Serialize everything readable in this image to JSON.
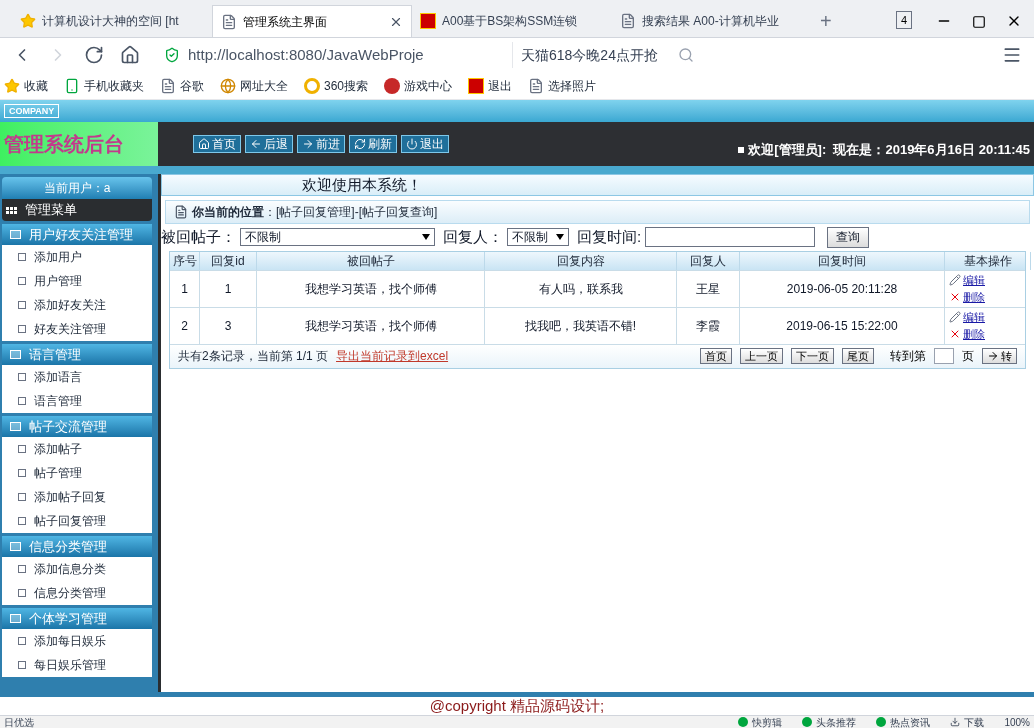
{
  "browser": {
    "tabs": [
      {
        "label": "计算机设计大神的空间 [ht",
        "selected": false,
        "kind": "star"
      },
      {
        "label": "管理系统主界面",
        "selected": true,
        "kind": "page"
      },
      {
        "label": "A00基于BS架构SSM连锁",
        "selected": false,
        "kind": "red"
      },
      {
        "label": "搜索结果 A00-计算机毕业",
        "selected": false,
        "kind": "page"
      }
    ],
    "tab_count": "4",
    "new_tab": "+",
    "address": "http://localhost:8080/JavaWebProje",
    "search_hint": "天猫618今晚24点开抢",
    "bookmarks": [
      {
        "label": "收藏",
        "kind": "star"
      },
      {
        "label": "手机收藏夹",
        "kind": "phone"
      },
      {
        "label": "谷歌",
        "kind": "page"
      },
      {
        "label": "网址大全",
        "kind": "globe"
      },
      {
        "label": "360搜索",
        "kind": "ring"
      },
      {
        "label": "游戏中心",
        "kind": "game"
      },
      {
        "label": "退出",
        "kind": "red"
      },
      {
        "label": "选择照片",
        "kind": "page"
      }
    ]
  },
  "header": {
    "company": "COMPANY",
    "title": "管理系统后台",
    "nav": [
      "首页",
      "后退",
      "前进",
      "刷新",
      "退出"
    ],
    "welcome": "欢迎[管理员]:  现在是：2019年6月16日 20:11:45"
  },
  "sidebar": {
    "current_user": "当前用户：a",
    "menu_title": "管理菜单",
    "groups": [
      {
        "title": "用户好友关注管理",
        "items": [
          "添加用户",
          "用户管理",
          "添加好友关注",
          "好友关注管理"
        ]
      },
      {
        "title": "语言管理",
        "items": [
          "添加语言",
          "语言管理"
        ]
      },
      {
        "title": "帖子交流管理",
        "items": [
          "添加帖子",
          "帖子管理",
          "添加帖子回复",
          "帖子回复管理"
        ]
      },
      {
        "title": "信息分类管理",
        "items": [
          "添加信息分类",
          "信息分类管理"
        ]
      },
      {
        "title": "个体学习管理",
        "items": [
          "添加每日娱乐",
          "每日娱乐管理"
        ]
      }
    ]
  },
  "main": {
    "welcome": "欢迎使用本系统！",
    "breadcrumb": "**你当前的位置**：[帖子回复管理]-[帖子回复查询]",
    "filters": {
      "post_label": "被回帖子：",
      "post_value": "不限制",
      "replier_label": "回复人：",
      "replier_value": "不限制",
      "time_label": "回复时间:",
      "search_button": "查询"
    },
    "table": {
      "columns": [
        "序号",
        "回复id",
        "被回帖子",
        "回复内容",
        "回复人",
        "回复时间",
        "基本操作"
      ],
      "rows": [
        {
          "cells": [
            "1",
            "1",
            "我想学习英语，找个师傅",
            "有人吗，联系我",
            "王星",
            "2019-06-05 20:11:28"
          ],
          "actions": [
            "编辑",
            "删除"
          ]
        },
        {
          "cells": [
            "2",
            "3",
            "我想学习英语，找个师傅",
            "找我吧，我英语不错!",
            "李霞",
            "2019-06-15 15:22:00"
          ],
          "actions": [
            "编辑",
            "删除"
          ]
        }
      ]
    },
    "pager": {
      "summary": "共有2条记录，当前第 1/1 页",
      "export": "导出当前记录到excel",
      "buttons": [
        "首页",
        "上一页",
        "下一页",
        "尾页"
      ],
      "goto_label": "转到第",
      "goto_unit": "页",
      "go_button": "转"
    }
  },
  "footer": "@copyright 精品源码设计;",
  "status_bar": {
    "left": "日优选",
    "items": [
      "快剪辑",
      "头条推荐",
      "热点资讯",
      "下载"
    ],
    "zoom": "100%"
  }
}
